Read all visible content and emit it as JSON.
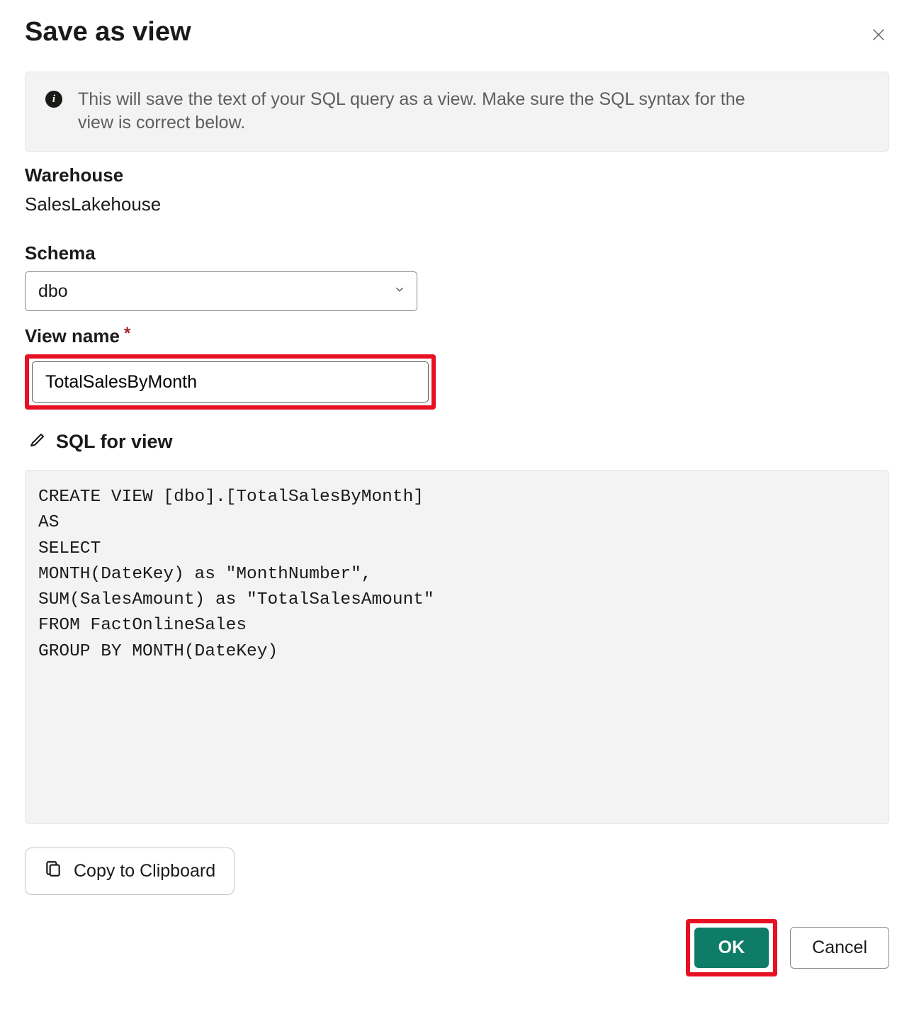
{
  "dialog": {
    "title": "Save as view",
    "info_text": "This will save the text of your SQL query as a view. Make sure the SQL syntax for the view is correct below."
  },
  "fields": {
    "warehouse_label": "Warehouse",
    "warehouse_value": "SalesLakehouse",
    "schema_label": "Schema",
    "schema_value": "dbo",
    "viewname_label": "View name",
    "viewname_required": "*",
    "viewname_value": "TotalSalesByMonth",
    "sql_section_label": "SQL for view",
    "sql_text": "CREATE VIEW [dbo].[TotalSalesByMonth]\nAS\nSELECT\nMONTH(DateKey) as \"MonthNumber\",\nSUM(SalesAmount) as \"TotalSalesAmount\"\nFROM FactOnlineSales\nGROUP BY MONTH(DateKey)"
  },
  "buttons": {
    "copy_label": "Copy to Clipboard",
    "ok_label": "OK",
    "cancel_label": "Cancel"
  }
}
